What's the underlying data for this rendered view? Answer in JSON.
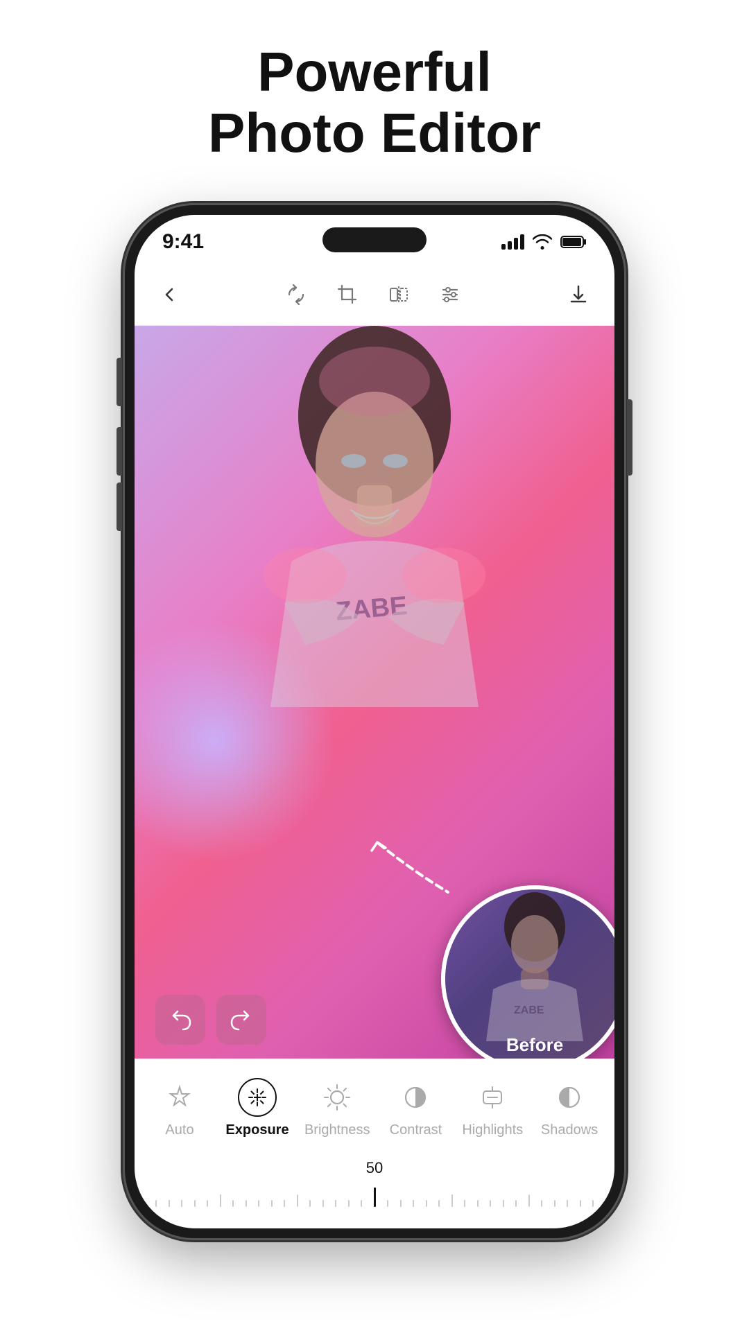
{
  "page": {
    "title_line1": "Powerful",
    "title_line2": "Photo Editor"
  },
  "status_bar": {
    "time": "9:41"
  },
  "toolbar": {
    "back_label": "‹",
    "tools": [
      "rotate",
      "crop",
      "flip",
      "adjust",
      "download"
    ]
  },
  "edit_tools": [
    {
      "id": "auto",
      "label": "Auto",
      "active": false
    },
    {
      "id": "exposure",
      "label": "Exposure",
      "active": true
    },
    {
      "id": "brightness",
      "label": "Brightness",
      "active": false
    },
    {
      "id": "contrast",
      "label": "Contrast",
      "active": false
    },
    {
      "id": "highlights",
      "label": "Highlights",
      "active": false
    },
    {
      "id": "shadows",
      "label": "Shadows",
      "active": false
    }
  ],
  "slider": {
    "value": "50"
  },
  "before_label": "Before"
}
